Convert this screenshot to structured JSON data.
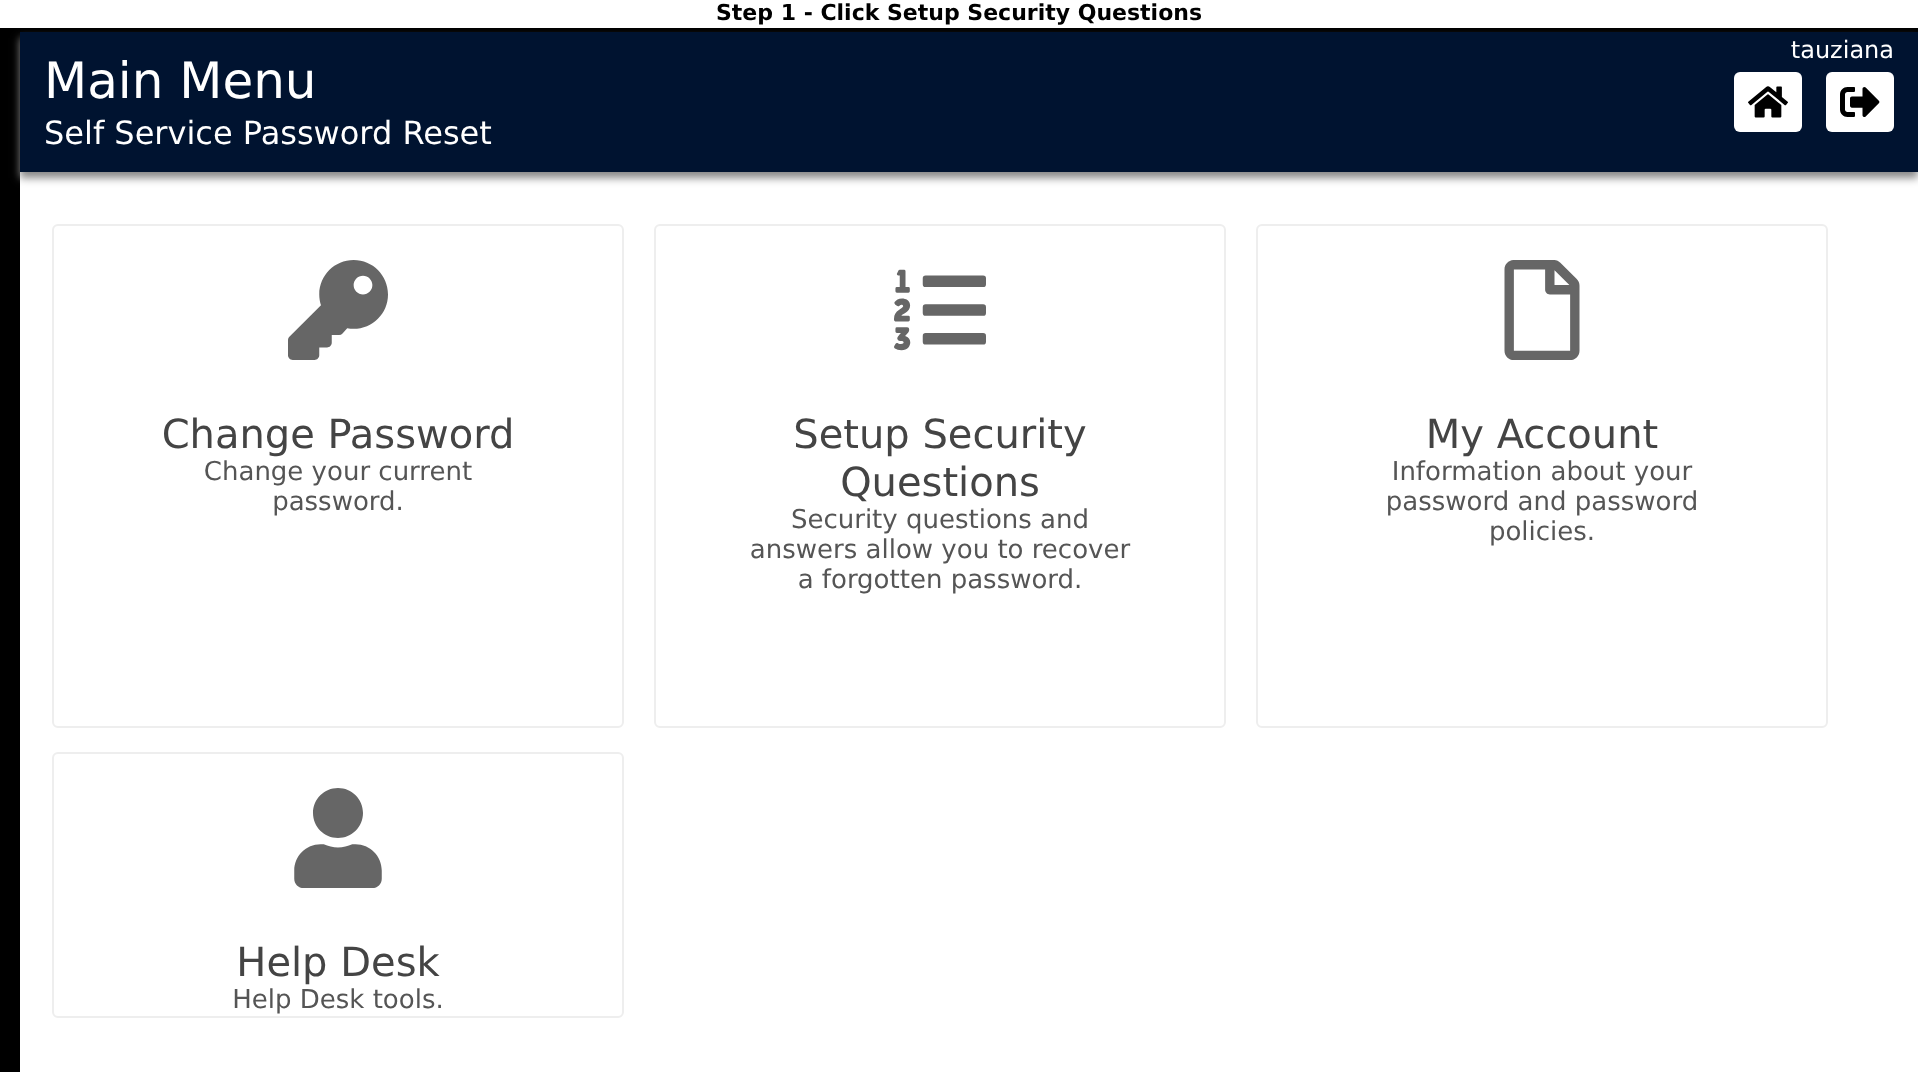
{
  "caption": "Step 1 - Click Setup Security Questions",
  "header": {
    "title": "Main Menu",
    "subtitle": "Self Service Password Reset",
    "username": "tauziana"
  },
  "header_buttons": [
    {
      "kind": "home"
    },
    {
      "kind": "logout"
    }
  ],
  "tiles": [
    {
      "kind": "key",
      "title": "Change Password",
      "description": "Change your current password."
    },
    {
      "kind": "list",
      "title": "Setup Security Questions",
      "description": "Security questions and answers allow you to recover a forgotten password."
    },
    {
      "kind": "file",
      "title": "My Account",
      "description": "Information about your password and password policies."
    },
    {
      "kind": "user",
      "title": "Help Desk",
      "description": "Help Desk tools."
    }
  ]
}
